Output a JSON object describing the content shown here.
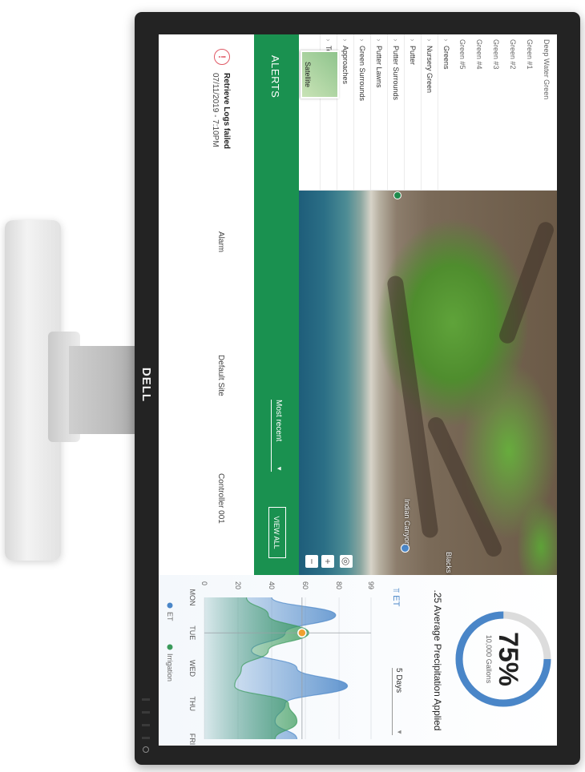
{
  "monitor": {
    "brand": "DELL"
  },
  "map": {
    "satellite_label": "Satellite",
    "place_labels": [
      "Indian Canyon",
      "Blacks B"
    ],
    "zoom_in": "+",
    "zoom_out": "−",
    "locate": "◎",
    "layers": [
      {
        "label": "Deep Water Green",
        "sub": true
      },
      {
        "label": "Green #1",
        "sub": true
      },
      {
        "label": "Green #2",
        "sub": true
      },
      {
        "label": "Green #3",
        "sub": true
      },
      {
        "label": "Green #4",
        "sub": true
      },
      {
        "label": "Green #5",
        "sub": true
      },
      {
        "label": "Greens",
        "sub": false
      },
      {
        "label": "Nursery Green",
        "sub": false
      },
      {
        "label": "Putter",
        "sub": false
      },
      {
        "label": "Putter Surrounds",
        "sub": false
      },
      {
        "label": "Putter Lawns",
        "sub": false
      },
      {
        "label": "Green Surrounds",
        "sub": false
      },
      {
        "label": "Approaches",
        "sub": false
      },
      {
        "label": "Tees",
        "sub": false
      }
    ]
  },
  "alerts": {
    "title": "ALERTS",
    "sort_label": "Most recent",
    "view_all": "VIEW ALL",
    "items": [
      {
        "icon": "alert-circle-icon",
        "title": "Retrieve Logs failed",
        "time": "07/11/2019 - 7:10PM",
        "type": "Alarm",
        "site": "Default Site",
        "controller": "Controller 001"
      }
    ]
  },
  "summary": {
    "gauge_value": "75%",
    "gauge_fraction": 0.75,
    "gauge_sub": "10,000 Gallons",
    "precip_text": ".25 Average Precipitation Applied",
    "et_label": "ET",
    "range_select": "5 Days",
    "colors": {
      "et": "#4a86c8",
      "irrigation": "#3a9a5b",
      "marker": "#f0a030",
      "gauge_track": "#dcdcdc"
    }
  },
  "chart_data": {
    "type": "area",
    "categories": [
      "MON",
      "TUE",
      "WED",
      "THU",
      "FRI"
    ],
    "y_ticks": [
      "99",
      "80",
      "60",
      "40",
      "20",
      "0"
    ],
    "ylim": [
      0,
      99
    ],
    "x": [
      0,
      0.5,
      1,
      1.5,
      2,
      2.5,
      3,
      3.5,
      4
    ],
    "series": [
      {
        "name": "ET",
        "values": [
          40,
          78,
          48,
          28,
          55,
          85,
          48,
          42,
          55
        ]
      },
      {
        "name": "Irrigation",
        "values": [
          25,
          38,
          62,
          38,
          22,
          18,
          50,
          55,
          42
        ]
      }
    ],
    "marker_point": {
      "x": 1,
      "y": 58
    }
  }
}
